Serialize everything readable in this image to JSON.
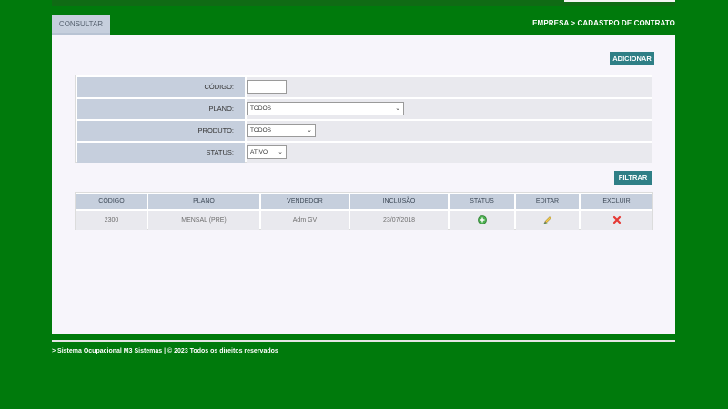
{
  "tabs": [
    {
      "label": "CONSULTAR"
    }
  ],
  "breadcrumb": "EMPRESA > CADASTRO DE CONTRATO",
  "add_button": "ADICIONAR",
  "filter": {
    "codigo": {
      "label": "CÓDIGO:",
      "value": ""
    },
    "plano": {
      "label": "PLANO:",
      "value": "TODOS"
    },
    "produto": {
      "label": "PRODUTO:",
      "value": "TODOS"
    },
    "status": {
      "label": "STATUS:",
      "value": "ATIVO"
    }
  },
  "filter_button": "FILTRAR",
  "table": {
    "columns": [
      "CÓDIGO",
      "PLANO",
      "VENDEDOR",
      "INCLUSÃO",
      "STATUS",
      "EDITAR",
      "EXCLUIR"
    ],
    "rows": [
      {
        "codigo": "2300",
        "plano": "MENSAL (PRE)",
        "vendedor": "Adm GV",
        "inclusao": "23/07/2018",
        "status_icon": "add-circle-icon",
        "edit_icon": "pencil-icon",
        "delete_icon": "x-icon"
      }
    ]
  },
  "footer": "> Sistema Ocupacional M3 Sistemas | © 2023 Todos os direitos reservados",
  "colors": {
    "background": "#007a0c",
    "accent": "#2f7f86",
    "header_cell": "#c6cfdd"
  }
}
